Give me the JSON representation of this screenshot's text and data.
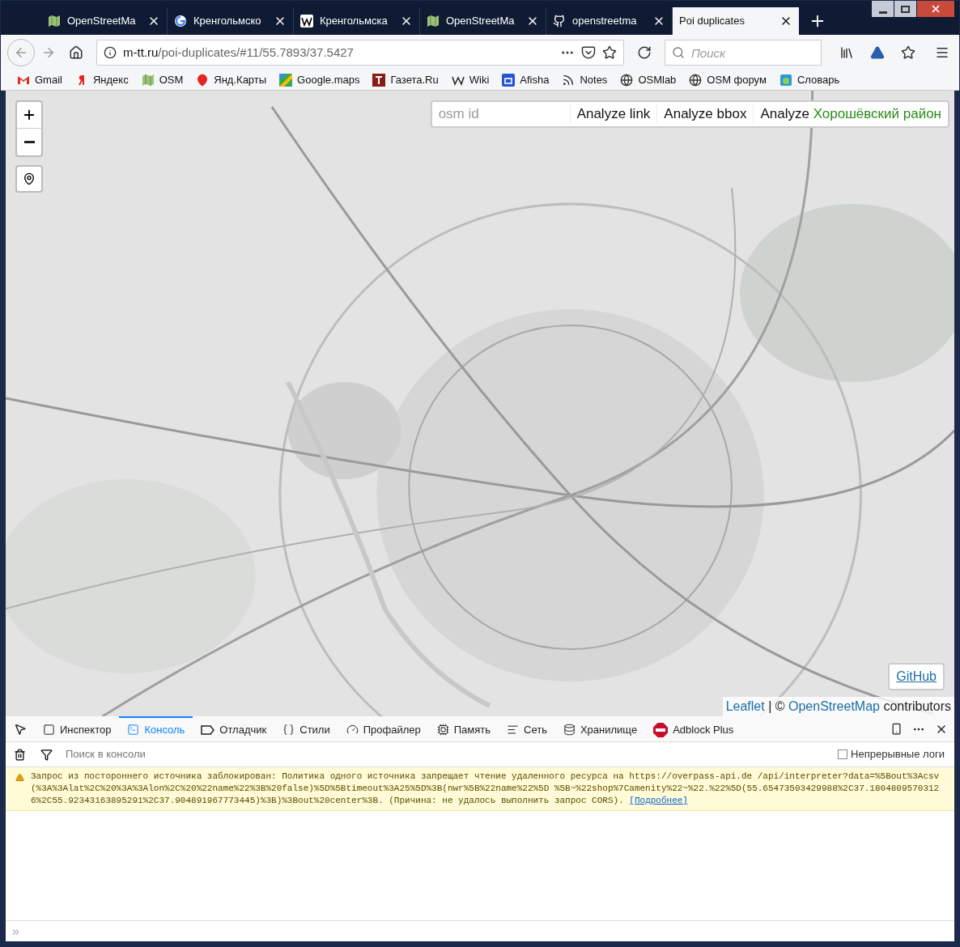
{
  "tabs": [
    {
      "title": "OpenStreetMa",
      "selected": false
    },
    {
      "title": "Кренгольмско",
      "selected": false
    },
    {
      "title": "Кренгольмска",
      "selected": false
    },
    {
      "title": "OpenStreetMa",
      "selected": false
    },
    {
      "title": "openstreetma",
      "selected": false
    },
    {
      "title": "Poi duplicates",
      "selected": true
    }
  ],
  "address": {
    "host": "m-tt.ru",
    "path": "/poi-duplicates/#11/55.7893/37.5427"
  },
  "search": {
    "placeholder": "Поиск"
  },
  "bookmarks": [
    {
      "label": "Gmail"
    },
    {
      "label": "Яндекс"
    },
    {
      "label": "OSM"
    },
    {
      "label": "Янд.Карты"
    },
    {
      "label": "Google.maps"
    },
    {
      "label": "Газета.Ru"
    },
    {
      "label": "Wiki"
    },
    {
      "label": "Afisha"
    },
    {
      "label": "Notes"
    },
    {
      "label": "OSMlab"
    },
    {
      "label": "OSM форум"
    },
    {
      "label": "Словарь"
    }
  ],
  "map": {
    "kind": "picture",
    "osm_field": {
      "placeholder": "osm id"
    },
    "actions": [
      {
        "label": "Analyze link"
      },
      {
        "label": "Analyze bbox"
      },
      {
        "label": "Analyze",
        "district": "Хорошёвский район"
      }
    ],
    "github": "GitHub",
    "attribution": {
      "leaflet": "Leaflet",
      "separator": "| ©",
      "osm": "OpenStreetMap",
      "rest": "contributors"
    }
  },
  "devtools": {
    "tabs": [
      {
        "label": "Инспектор",
        "selected": false
      },
      {
        "label": "Консоль",
        "selected": true
      },
      {
        "label": "Отладчик",
        "selected": false
      },
      {
        "label": "Стили",
        "selected": false
      },
      {
        "label": "Профайлер",
        "selected": false
      },
      {
        "label": "Память",
        "selected": false
      },
      {
        "label": "Сеть",
        "selected": false
      },
      {
        "label": "Хранилище",
        "selected": false
      },
      {
        "label": "Adblock Plus",
        "selected": false
      }
    ],
    "filter": {
      "placeholder": "Поиск в консоли"
    },
    "persist": {
      "label": "Непрерывные логи",
      "checked": false
    },
    "messages": [
      {
        "kind": "warning",
        "text": "Запрос из постороннего источника заблокирован: Политика одного источника запрещает чтение удаленного ресурса на https://overpass-api.de /api/interpreter?data=%5Bout%3Acsv(%3A%3Alat%2C%20%3A%3Alon%2C%20%22name%22%3B%20false)%5D%5Btimeout%3A25%5D%3B(nwr%5B%22name%22%5D %5B~%22shop%7Camenity%22~%22.%22%5D(55.65473503429988%2C37.18048095703126%2C55.92343163895291%2C37.904891967773445)%3B)%3Bout%20center%3B. (Причина: не удалось выполнить запрос CORS).",
        "link": "[Подробнее]"
      }
    ],
    "prompt": "»"
  }
}
